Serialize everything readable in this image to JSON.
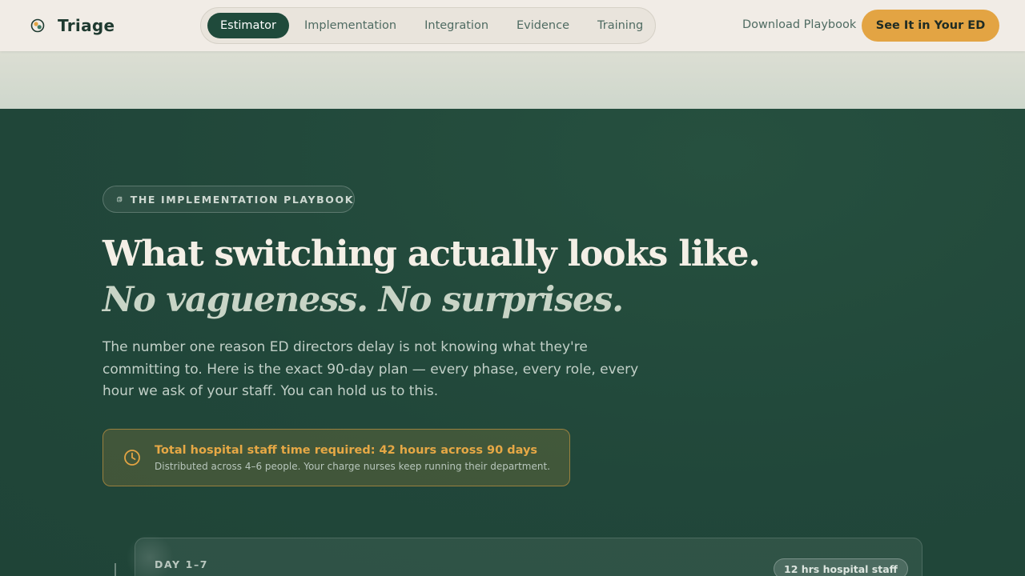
{
  "header": {
    "brand": "Triage",
    "nav": [
      {
        "label": "Estimator",
        "active": true
      },
      {
        "label": "Implementation",
        "active": false
      },
      {
        "label": "Integration",
        "active": false
      },
      {
        "label": "Evidence",
        "active": false
      },
      {
        "label": "Training",
        "active": false
      }
    ],
    "download_label": "Download Playbook",
    "cta_label": "See It in Your ED"
  },
  "hero": {
    "eyebrow": "THE IMPLEMENTATION PLAYBOOK",
    "headline": "What switching actually looks like.",
    "subheadline": "No vagueness. No surprises.",
    "lede": "The number one reason ED directors delay is not knowing what they're committing to. Here is the exact 90-day plan — every phase, every role, every hour we ask of your staff. You can hold us to this.",
    "callout": {
      "title": "Total hospital staff time required: 42 hours across 90 days",
      "subtitle": "Distributed across 4–6 people. Your charge nurses keep running their department."
    }
  },
  "phases": [
    {
      "day_range": "DAY 1–7",
      "hours_badge": "12 hrs hospital staff"
    }
  ],
  "colors": {
    "accent": "#e3a443",
    "hero_bg": "#21473a",
    "header_bg": "#f1ece6",
    "active_tab": "#1f4a3b"
  },
  "icons": {
    "brand": "triage-logo-icon",
    "eyebrow": "document-stack-icon",
    "callout": "clock-icon"
  }
}
